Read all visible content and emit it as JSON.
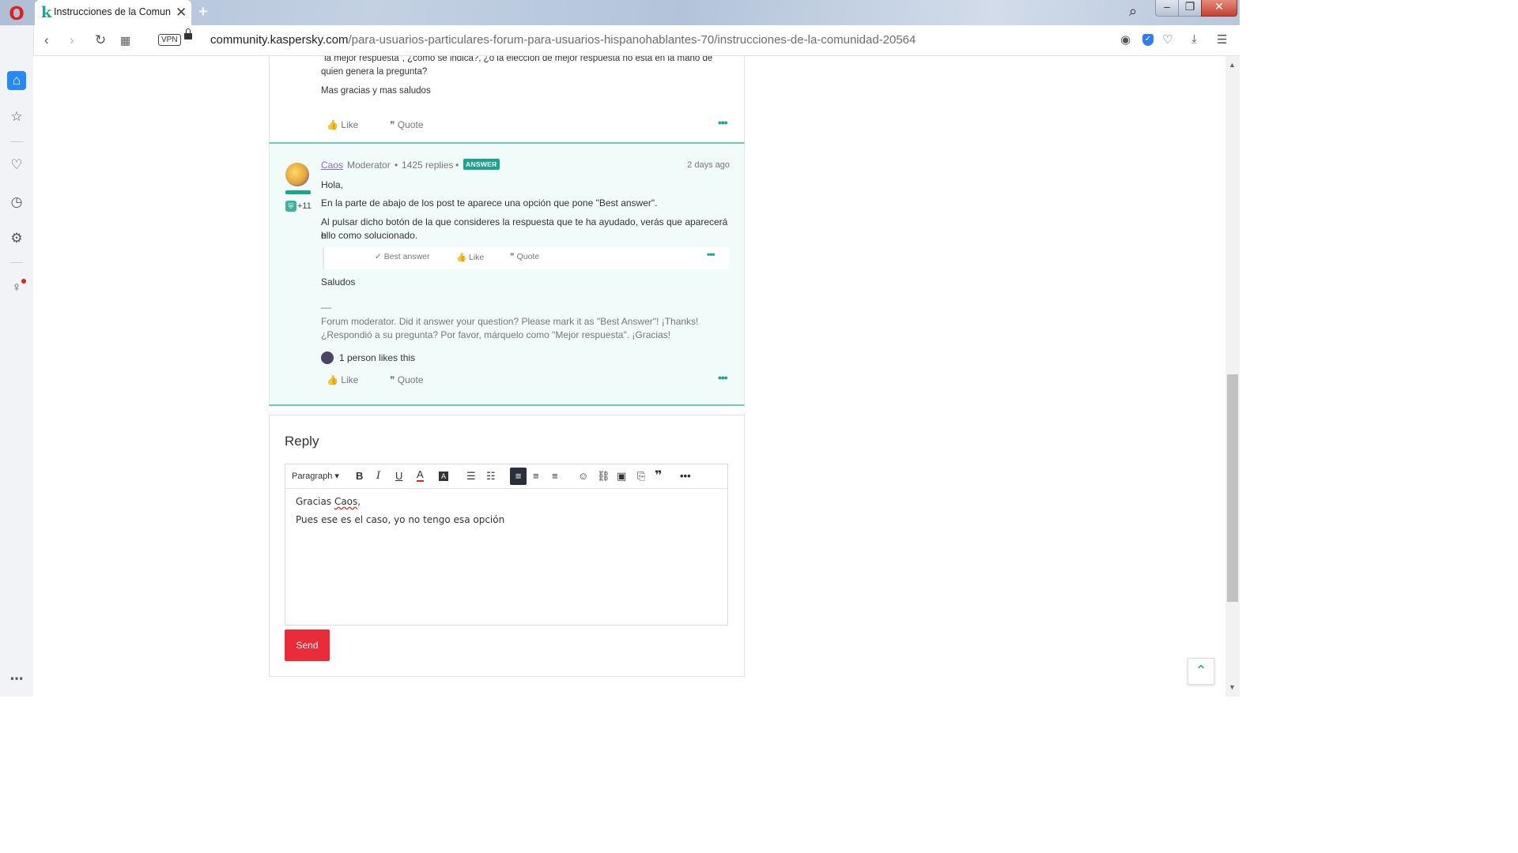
{
  "browser": {
    "tab_title": "Instrucciones de la Comuni",
    "tab_favicon": "k",
    "url_host": "community.kaspersky.com",
    "url_path": "/para-usuarios-particulares-forum-para-usuarios-hispanohablantes-70/instrucciones-de-la-comunidad-20564",
    "vpn_label": "VPN",
    "accent": "#2689f5"
  },
  "previous_post": {
    "line1": "\"la mejor respuesta\", ¿como se indica?, ¿o la elección de mejor respuesta no esta en la mano de",
    "line2": "quien genera la pregunta?",
    "line3": "Mas gracias y mas saludos",
    "like_label": "Like",
    "quote_label": "Quote"
  },
  "answer_post": {
    "author": "Caos",
    "role": "Moderator",
    "replies": "1425 replies",
    "badge": "ANSWER",
    "badge_count": "+11",
    "time": "2 days ago",
    "greeting": "Hola,",
    "p1": "En la parte de abajo de los post te aparece una opción que pone \"Best answer\".",
    "p2a": "Al pulsar dicho botón de la que consideres la respuesta que te ha ayudado, verás que aparecerá el",
    "p2b": "hilo como solucionado.",
    "inner_best": "Best answer",
    "inner_like": "Like",
    "inner_quote": "Quote",
    "closing": "Saludos",
    "sig_sep": "__",
    "sig1": "Forum moderator. Did it answer your question? Please mark it as \"Best Answer\"! ¡Thanks!",
    "sig2": "¿Respondió a su pregunta? Por favor, márquelo como \"Mejor respuesta\". ¡Gracias!",
    "likes_text": "1 person likes this",
    "like_label": "Like",
    "quote_label": "Quote",
    "accent": "#1aa48a"
  },
  "reply": {
    "title": "Reply",
    "paragraph_select": "Paragraph",
    "line1_a": "Gracias ",
    "line1_b": "Caos",
    "line1_c": ",",
    "line2": "Pues ese es el caso, yo no tengo esa opción",
    "send_label": "Send",
    "send_color": "#ea2b39"
  }
}
